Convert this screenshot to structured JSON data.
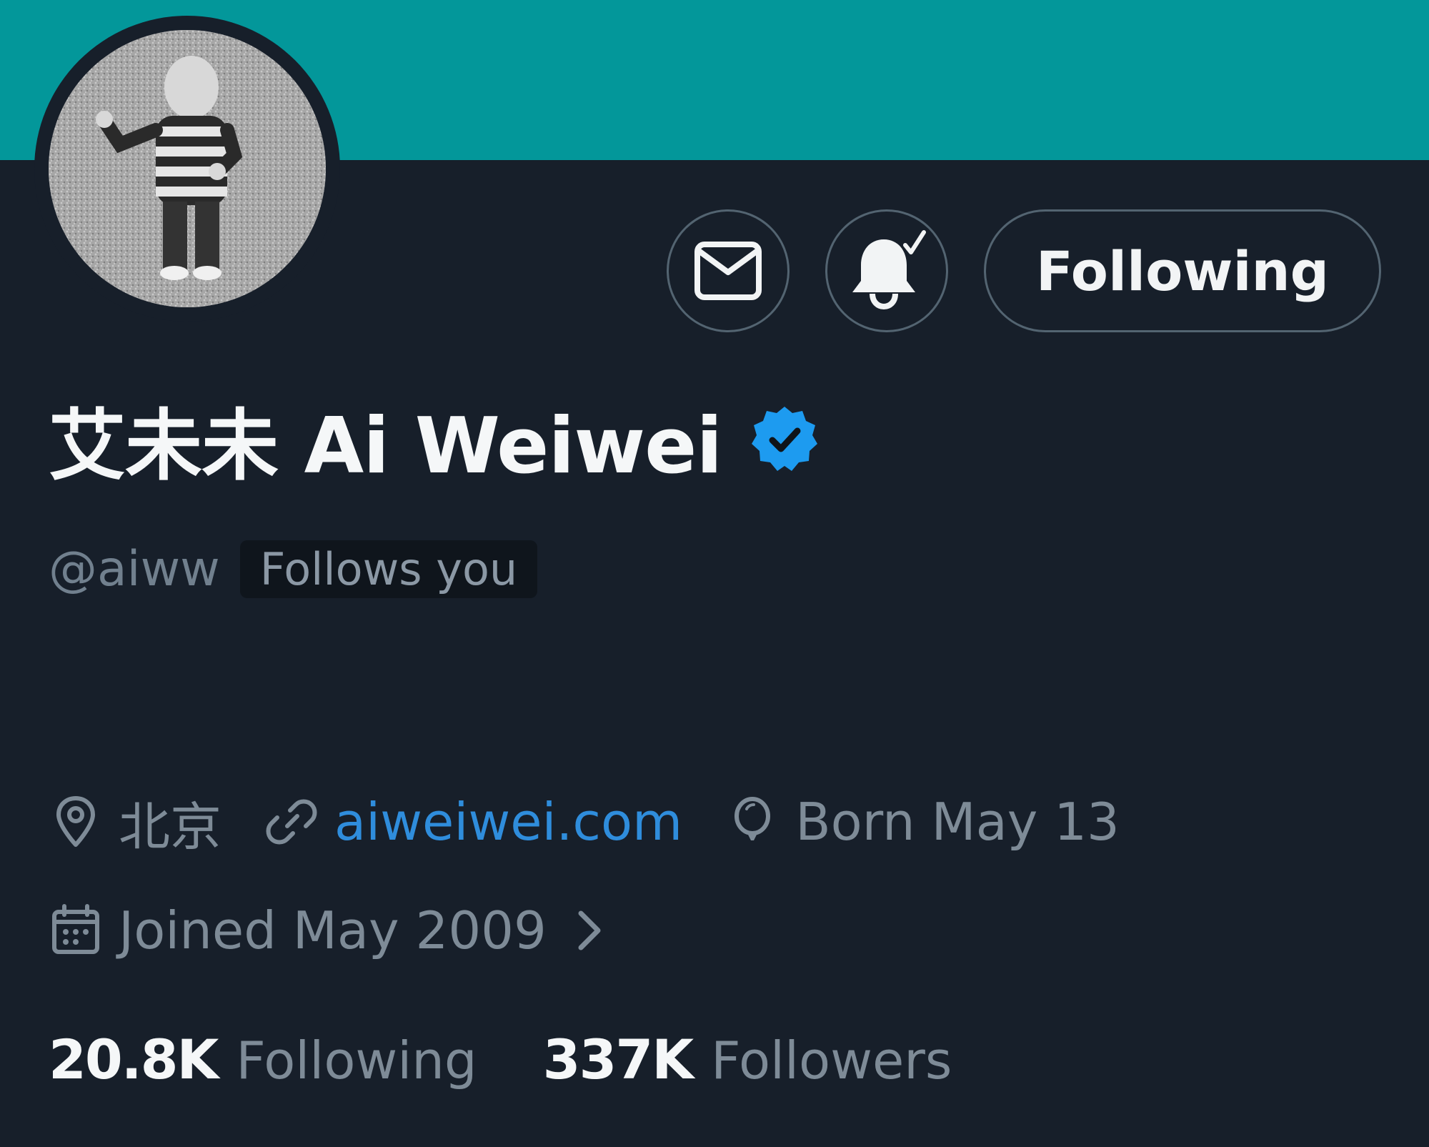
{
  "profile": {
    "display_name": "艾未未 Ai Weiwei",
    "handle": "@aiww",
    "follows_you": "Follows you",
    "verified": true
  },
  "actions": {
    "following_label": "Following"
  },
  "meta": {
    "location": "北京",
    "website": "aiweiwei.com",
    "birthday": "Born May 13",
    "joined": "Joined May 2009"
  },
  "stats": {
    "following_count": "20.8K",
    "following_label": "Following",
    "followers_count": "337K",
    "followers_label": "Followers"
  },
  "colors": {
    "banner": "#03979a",
    "background": "#171f2a",
    "verified_badge": "#1d9bf0",
    "link": "#2f8ddc"
  },
  "icons": [
    "mail-icon",
    "bell-notify-icon",
    "verified-badge-icon",
    "location-icon",
    "link-icon",
    "balloon-icon",
    "calendar-icon",
    "chevron-right-icon"
  ]
}
